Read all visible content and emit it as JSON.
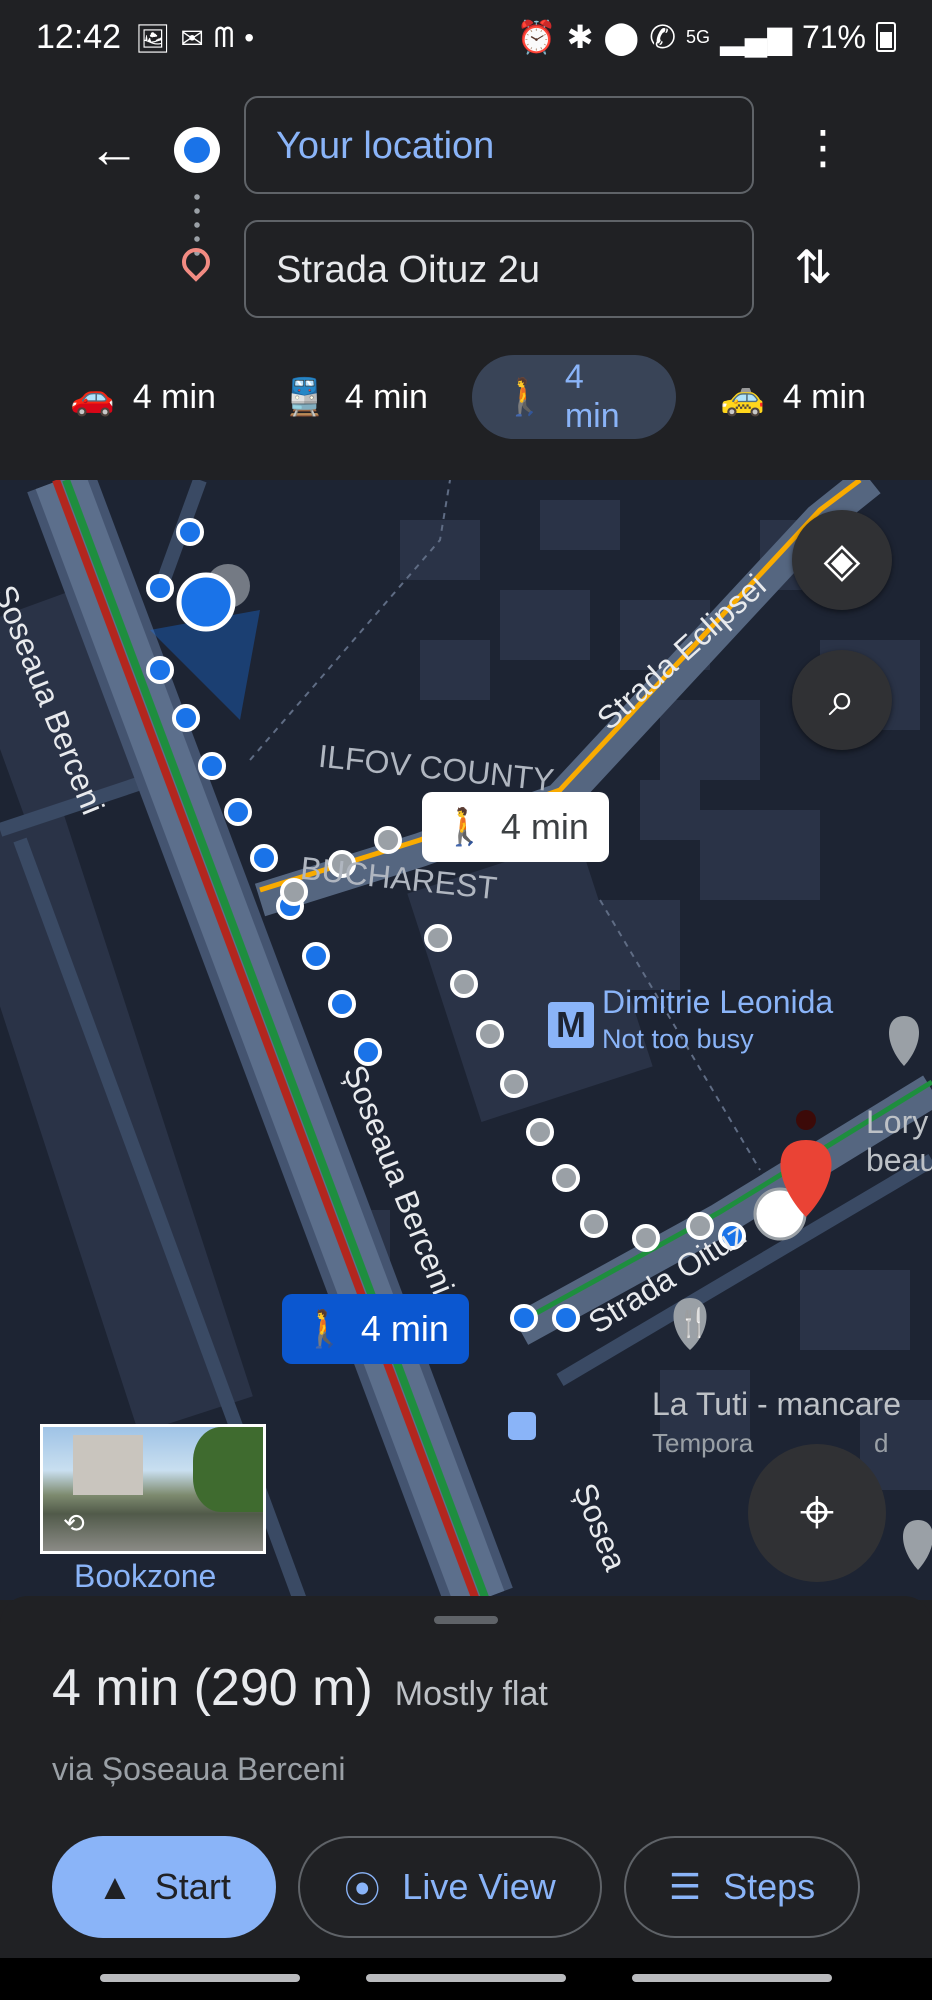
{
  "status": {
    "time": "12:42",
    "left_icons": [
      "gallery-icon",
      "gmail-icon",
      "mcdonalds-icon",
      "dot-icon"
    ],
    "network": "5G",
    "battery": "71%"
  },
  "directions": {
    "origin": "Your location",
    "destination": "Strada Oituz 2u"
  },
  "modes": [
    {
      "name": "drive",
      "icon": "car-icon",
      "time": "4 min"
    },
    {
      "name": "transit",
      "icon": "train-icon",
      "time": "4 min"
    },
    {
      "name": "walk",
      "icon": "walk-icon",
      "time": "4 min",
      "selected": true
    },
    {
      "name": "ride",
      "icon": "ride-icon",
      "time": "4 min"
    }
  ],
  "map": {
    "labels": {
      "street_berceni_top": "Șoseaua Berceni",
      "street_berceni_mid": "Șoseaua Berceni",
      "street_berceni_bottom": "Șosea",
      "street_eclipsei": "Strada Eclipsei",
      "street_oituz": "Strada Oituz",
      "county": "ILFOV COUNTY",
      "city": "BUCHAREST",
      "metro_name": "Dimitrie Leonida",
      "metro_status": "Not too busy",
      "metro_letter": "M",
      "poi_lory_1": "Lory",
      "poi_lory_2": "beau",
      "restaurant_name": "La Tuti - mancare",
      "restaurant_status": "Tempora",
      "restaurant_status_end": "d",
      "streetview_place": "Bookzone"
    },
    "route_bubble_alt": "4 min",
    "route_bubble_main": "4 min"
  },
  "summary": {
    "duration": "4 min (290 m)",
    "terrain": "Mostly flat",
    "via": "via Șoseaua Berceni"
  },
  "actions": {
    "start": "Start",
    "live_view": "Live View",
    "steps": "Steps"
  },
  "colors": {
    "accent": "#8ab4f8",
    "route_blue": "#1a73e8",
    "selected_chip": "#394457",
    "destination_pin": "#ea4335"
  }
}
